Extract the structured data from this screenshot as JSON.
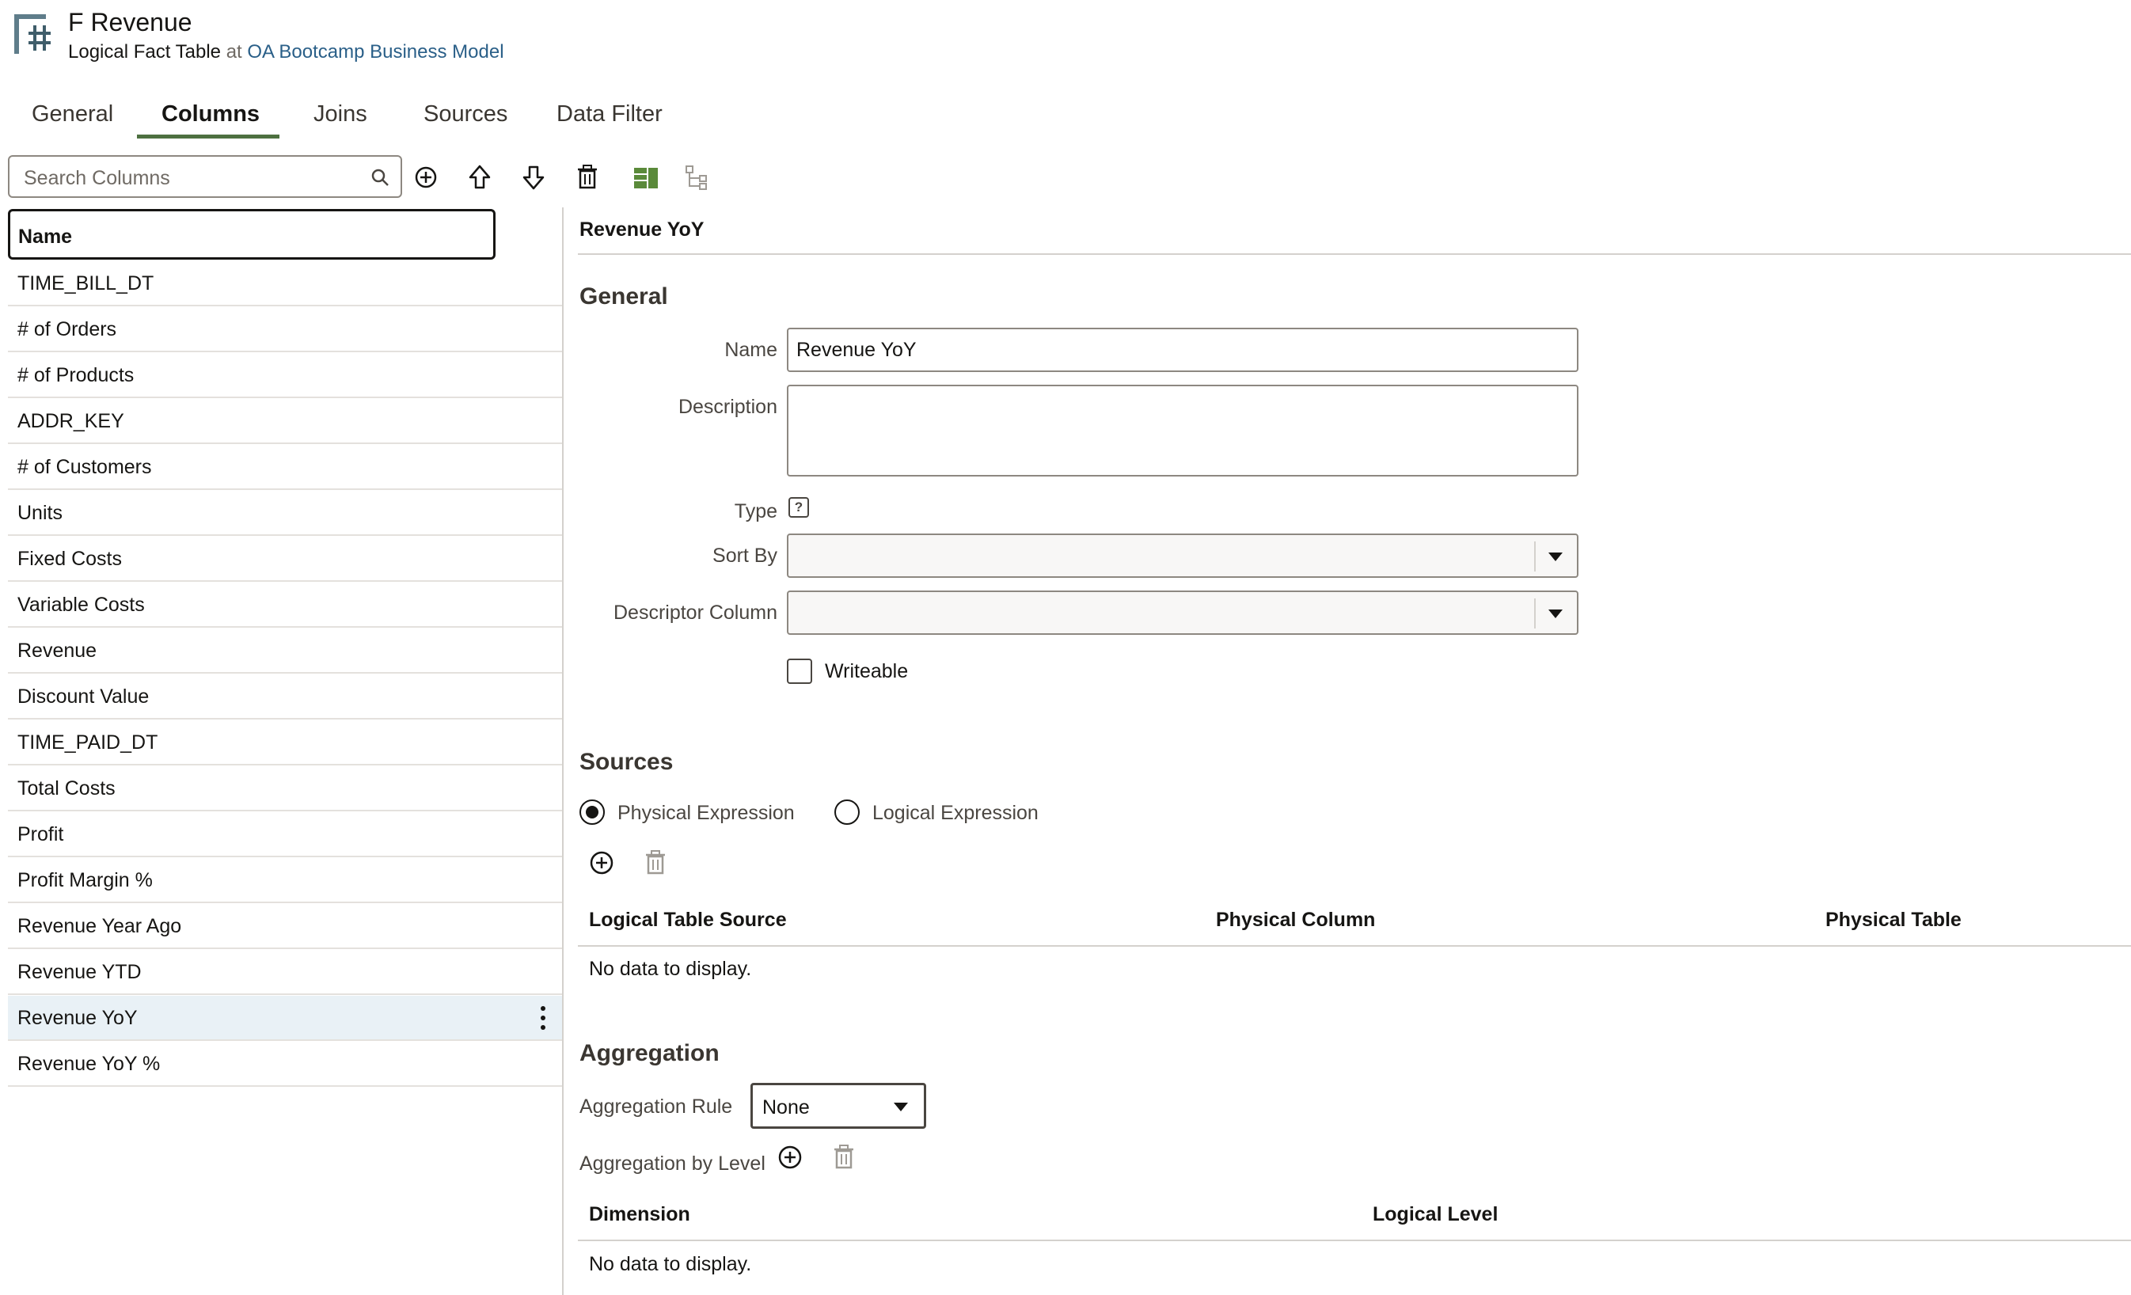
{
  "header": {
    "title": "F Revenue",
    "subtitle_type": "Logical Fact Table",
    "subtitle_at": "at",
    "subtitle_link": "OA Bootcamp Business Model",
    "icon": "logical-fact-table-icon"
  },
  "tabs": [
    {
      "label": "General",
      "active": false
    },
    {
      "label": "Columns",
      "active": true
    },
    {
      "label": "Joins",
      "active": false
    },
    {
      "label": "Sources",
      "active": false
    },
    {
      "label": "Data Filter",
      "active": false
    }
  ],
  "toolbar": {
    "search_placeholder": "Search Columns",
    "icons": [
      "add-icon",
      "move-up-icon",
      "move-down-icon",
      "delete-icon",
      "column-layout-icon",
      "hierarchy-icon"
    ]
  },
  "columns_list": {
    "header": "Name",
    "items": [
      "TIME_BILL_DT",
      "# of Orders",
      "# of Products",
      "ADDR_KEY",
      "# of Customers",
      "Units",
      "Fixed Costs",
      "Variable Costs",
      "Revenue",
      "Discount Value",
      "TIME_PAID_DT",
      "Total Costs",
      "Profit",
      "Profit Margin %",
      "Revenue Year Ago",
      "Revenue YTD",
      "Revenue YoY",
      "Revenue YoY %"
    ],
    "selected": "Revenue YoY"
  },
  "detail": {
    "title": "Revenue YoY",
    "general": {
      "heading": "General",
      "name_label": "Name",
      "name_value": "Revenue YoY",
      "description_label": "Description",
      "description_value": "",
      "type_label": "Type",
      "type_help": "?",
      "sort_by_label": "Sort By",
      "sort_by_value": "",
      "descriptor_label": "Descriptor Column",
      "descriptor_value": "",
      "writeable_label": "Writeable",
      "writeable_checked": false
    },
    "sources": {
      "heading": "Sources",
      "physical_label": "Physical Expression",
      "logical_label": "Logical Expression",
      "selected": "Physical Expression",
      "columns": [
        "Logical Table Source",
        "Physical Column",
        "Physical Table"
      ],
      "empty_text": "No data to display."
    },
    "aggregation": {
      "heading": "Aggregation",
      "rule_label": "Aggregation Rule",
      "rule_value": "None",
      "level_label": "Aggregation by Level",
      "columns": [
        "Dimension",
        "Logical Level"
      ],
      "empty_text": "No data to display."
    }
  },
  "colors": {
    "accent_tab": "#4d7040",
    "link": "#2a5f88",
    "selected_row": "#e9f1f6",
    "layout_icon": "#5a8a3a"
  }
}
